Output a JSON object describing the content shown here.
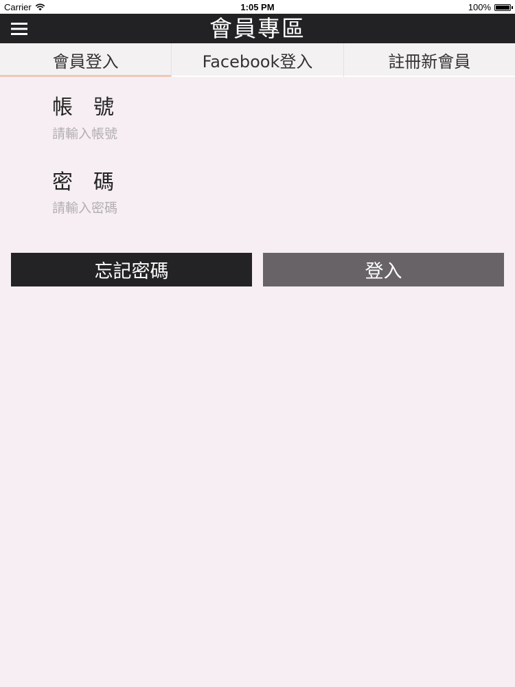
{
  "status_bar": {
    "carrier": "Carrier",
    "time": "1:05 PM",
    "battery": "100%"
  },
  "nav": {
    "title": "會員專區",
    "menu_icon": "hamburger-menu-icon"
  },
  "tabs": [
    {
      "label": "會員登入",
      "active": true
    },
    {
      "label": "Facebook登入",
      "active": false
    },
    {
      "label": "註冊新會員",
      "active": false
    }
  ],
  "form": {
    "account_label": "帳　號",
    "account_placeholder": "請輸入帳號",
    "password_label": "密　碼",
    "password_placeholder": "請輸入密碼"
  },
  "buttons": {
    "forgot_label": "忘記密碼",
    "login_label": "登入"
  },
  "colors": {
    "background": "#f6eef2",
    "nav_bar": "#222224",
    "forgot_button": "#232325",
    "login_button": "#686366",
    "active_tab_underline": "#f0c8b8"
  }
}
